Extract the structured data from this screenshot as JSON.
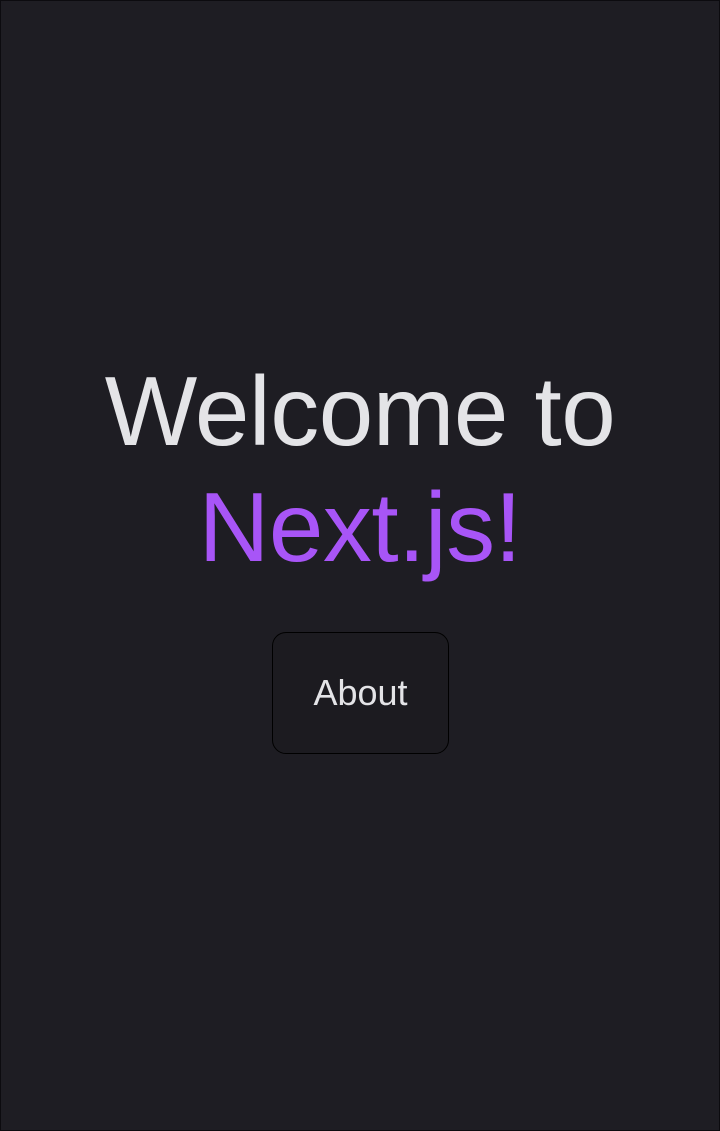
{
  "hero": {
    "title_prefix": "Welcome to",
    "title_brand": "Next.js!"
  },
  "nav": {
    "about_label": "About"
  },
  "colors": {
    "background": "#1e1d23",
    "text": "#e4e4e7",
    "brand_accent": "#a855f7",
    "button_border": "#000000"
  }
}
